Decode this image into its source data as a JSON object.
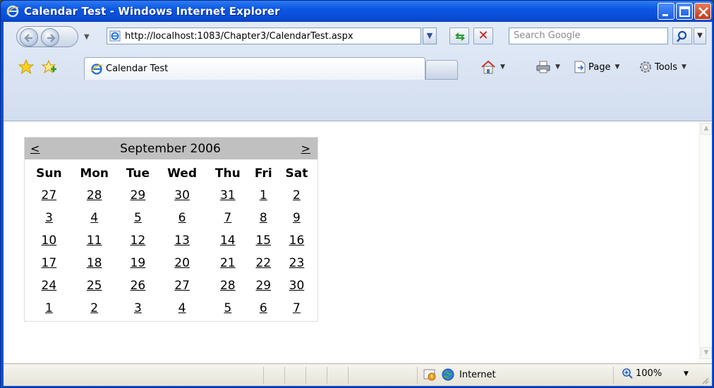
{
  "window": {
    "title": "Calendar Test - Windows Internet Explorer"
  },
  "address": {
    "url": "http://localhost:1083/Chapter3/CalendarTest.aspx"
  },
  "search": {
    "placeholder": "Search Google"
  },
  "tab": {
    "label": "Calendar Test"
  },
  "commands": {
    "page": "Page",
    "tools": "Tools"
  },
  "calendar": {
    "prev": "<",
    "next": ">",
    "title": "September 2006",
    "weekdays": [
      "Sun",
      "Mon",
      "Tue",
      "Wed",
      "Thu",
      "Fri",
      "Sat"
    ],
    "weeks": [
      [
        "27",
        "28",
        "29",
        "30",
        "31",
        "1",
        "2"
      ],
      [
        "3",
        "4",
        "5",
        "6",
        "7",
        "8",
        "9"
      ],
      [
        "10",
        "11",
        "12",
        "13",
        "14",
        "15",
        "16"
      ],
      [
        "17",
        "18",
        "19",
        "20",
        "21",
        "22",
        "23"
      ],
      [
        "24",
        "25",
        "26",
        "27",
        "28",
        "29",
        "30"
      ],
      [
        "1",
        "2",
        "3",
        "4",
        "5",
        "6",
        "7"
      ]
    ]
  },
  "status": {
    "zone": "Internet",
    "zoom": "100%"
  },
  "colors": {
    "titlebar": "#0a4fd2",
    "calendar_header": "#c0c0c0",
    "stop": "#c81616"
  }
}
